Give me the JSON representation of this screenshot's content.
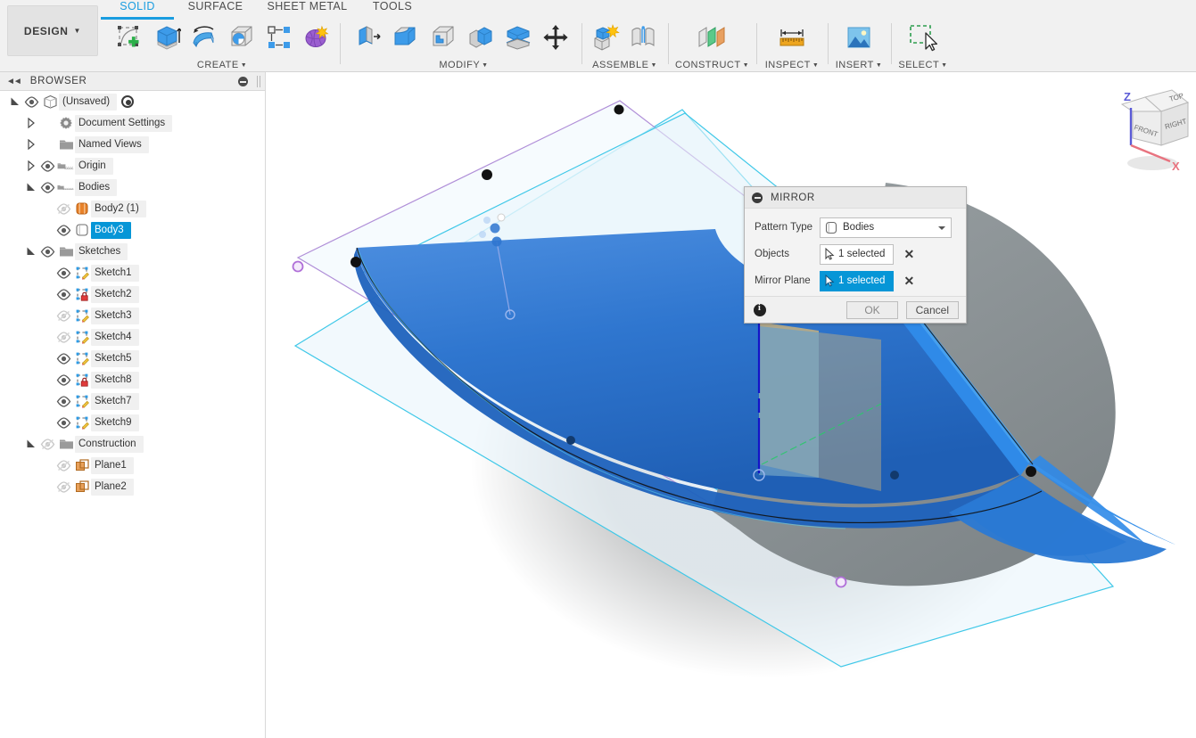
{
  "app": {
    "workspace_button": "DESIGN",
    "tabs": [
      {
        "label": "SOLID",
        "active": true
      },
      {
        "label": "SURFACE",
        "active": false
      },
      {
        "label": "SHEET METAL",
        "active": false
      },
      {
        "label": "TOOLS",
        "active": false
      }
    ],
    "accent_color": "#1a9de0",
    "selection_color": "#0696d7"
  },
  "ribbon": {
    "groups": [
      {
        "label": "CREATE",
        "has_dropdown": true,
        "buttons": [
          {
            "name": "create-sketch",
            "icon": "sketch-plus-icon"
          },
          {
            "name": "extrude",
            "icon": "extrude-icon"
          },
          {
            "name": "revolve",
            "icon": "revolve-icon"
          },
          {
            "name": "hole",
            "icon": "hole-icon"
          },
          {
            "name": "rectangular-pattern",
            "icon": "pattern-icon"
          },
          {
            "name": "form",
            "icon": "form-icon"
          }
        ]
      },
      {
        "label": "MODIFY",
        "has_dropdown": true,
        "buttons": [
          {
            "name": "press-pull",
            "icon": "press-pull-icon"
          },
          {
            "name": "fillet",
            "icon": "fillet-icon"
          },
          {
            "name": "shell",
            "icon": "shell-icon"
          },
          {
            "name": "combine",
            "icon": "combine-icon"
          },
          {
            "name": "split-body",
            "icon": "split-body-icon"
          },
          {
            "name": "move-copy",
            "icon": "move-copy-icon"
          }
        ]
      },
      {
        "label": "ASSEMBLE",
        "has_dropdown": true,
        "buttons": [
          {
            "name": "new-component",
            "icon": "new-component-icon"
          },
          {
            "name": "joint",
            "icon": "joint-icon"
          }
        ]
      },
      {
        "label": "CONSTRUCT",
        "has_dropdown": true,
        "buttons": [
          {
            "name": "offset-plane",
            "icon": "offset-plane-icon"
          }
        ]
      },
      {
        "label": "INSPECT",
        "has_dropdown": true,
        "buttons": [
          {
            "name": "measure",
            "icon": "measure-ruler-icon"
          }
        ]
      },
      {
        "label": "INSERT",
        "has_dropdown": true,
        "buttons": [
          {
            "name": "insert-image",
            "icon": "image-icon"
          }
        ]
      },
      {
        "label": "SELECT",
        "has_dropdown": true,
        "buttons": [
          {
            "name": "select-tool",
            "icon": "selection-marquee-cursor-icon"
          }
        ]
      }
    ]
  },
  "browser": {
    "title": "BROWSER",
    "collapse_icon": "double-chevron-left-icon",
    "minimize_icon": "minus-circle-icon",
    "tree": [
      {
        "label": "(Unsaved)",
        "depth": 0,
        "twist": "open",
        "eye": "visible",
        "icon": "document-cube-icon",
        "trailing": "radio",
        "selected": false
      },
      {
        "label": "Document Settings",
        "depth": 1,
        "twist": "closed",
        "eye": "none",
        "icon": "gear-icon",
        "selected": false
      },
      {
        "label": "Named Views",
        "depth": 1,
        "twist": "closed",
        "eye": "none",
        "icon": "folder-icon",
        "selected": false
      },
      {
        "label": "Origin",
        "depth": 1,
        "twist": "closed",
        "eye": "visible",
        "icon": "origin-folder-icon",
        "selected": false
      },
      {
        "label": "Bodies",
        "depth": 1,
        "twist": "open",
        "eye": "visible",
        "icon": "bodies-folder-icon",
        "selected": false
      },
      {
        "label": "Body2 (1)",
        "depth": 2,
        "twist": "none",
        "eye": "hidden",
        "icon": "body-orange-icon",
        "selected": false
      },
      {
        "label": "Body3",
        "depth": 2,
        "twist": "none",
        "eye": "visible",
        "icon": "body-white-icon",
        "selected": true
      },
      {
        "label": "Sketches",
        "depth": 1,
        "twist": "open",
        "eye": "visible",
        "icon": "folder-icon",
        "selected": false
      },
      {
        "label": "Sketch1",
        "depth": 2,
        "twist": "none",
        "eye": "visible",
        "icon": "sketch-pencil-icon",
        "selected": false
      },
      {
        "label": "Sketch2",
        "depth": 2,
        "twist": "none",
        "eye": "visible",
        "icon": "sketch-lock-icon",
        "selected": false
      },
      {
        "label": "Sketch3",
        "depth": 2,
        "twist": "none",
        "eye": "hidden",
        "icon": "sketch-pencil-icon",
        "selected": false
      },
      {
        "label": "Sketch4",
        "depth": 2,
        "twist": "none",
        "eye": "hidden",
        "icon": "sketch-pencil-icon",
        "selected": false
      },
      {
        "label": "Sketch5",
        "depth": 2,
        "twist": "none",
        "eye": "visible",
        "icon": "sketch-pencil-icon",
        "selected": false
      },
      {
        "label": "Sketch8",
        "depth": 2,
        "twist": "none",
        "eye": "visible",
        "icon": "sketch-lock-icon",
        "selected": false
      },
      {
        "label": "Sketch7",
        "depth": 2,
        "twist": "none",
        "eye": "visible",
        "icon": "sketch-pencil-icon",
        "selected": false
      },
      {
        "label": "Sketch9",
        "depth": 2,
        "twist": "none",
        "eye": "visible",
        "icon": "sketch-pencil-icon",
        "selected": false
      },
      {
        "label": "Construction",
        "depth": 1,
        "twist": "open",
        "eye": "hidden",
        "icon": "folder-icon",
        "selected": false
      },
      {
        "label": "Plane1",
        "depth": 2,
        "twist": "none",
        "eye": "hidden",
        "icon": "plane-orange-icon",
        "selected": false
      },
      {
        "label": "Plane2",
        "depth": 2,
        "twist": "none",
        "eye": "hidden",
        "icon": "plane-orange-icon",
        "selected": false
      }
    ]
  },
  "mirror_dialog": {
    "title": "MIRROR",
    "collapse_icon": "minus-circle-icon",
    "pattern_type_label": "Pattern Type",
    "pattern_type_value": "Bodies",
    "pattern_type_icon": "body-white-icon",
    "objects_label": "Objects",
    "objects_value": "1 selected",
    "objects_active": false,
    "mirror_plane_label": "Mirror Plane",
    "mirror_plane_value": "1 selected",
    "mirror_plane_active": true,
    "clear_icon": "x-clear-icon",
    "info_icon": "info-icon",
    "ok_label": "OK",
    "cancel_label": "Cancel"
  },
  "viewcube": {
    "faces": [
      "TOP",
      "FRONT",
      "RIGHT"
    ],
    "axis_z": "Z",
    "axis_x": "X",
    "z_color": "#5b5bd6",
    "x_color": "#e8737f"
  },
  "canvas": {
    "body_color": "#2d74cc",
    "grey_surface_color": "#8c9396",
    "plane_fill": "#eaf6fb",
    "plane_edge_cyan": "#3fc8e8",
    "plane_edge_purple": "#b08fd8",
    "origin_plane_tan": "#c8b27f",
    "origin_plane_blue": "#6fa0c4",
    "z_axis_color": "#1414c8"
  }
}
